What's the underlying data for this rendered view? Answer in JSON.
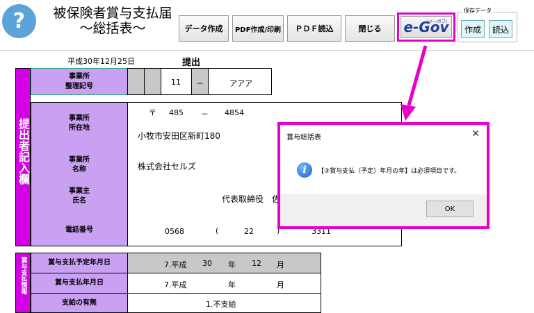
{
  "header": {
    "help_icon": "question-icon",
    "title_line1": "被保険者賞与支払届",
    "title_line2": "～総括表～"
  },
  "toolbar": {
    "create_data": "データ作成",
    "pdf_print": "PDF作成/印刷",
    "pdf_read": "ＰＤＦ読込",
    "close": "閉じる",
    "egov_prefix": "e-",
    "egov_main": "Gov",
    "egov_kana": "(イーガブ)"
  },
  "save_data": {
    "label": "保存データ",
    "create": "作成",
    "load": "読込"
  },
  "form": {
    "date": "平成30年12月25日",
    "submit": "提出",
    "section1_title": "提出者記入欄",
    "office_number_label": "事業所\n整理記号",
    "office_code_1": "11",
    "office_code_dash": "－",
    "office_code_2": "アアア",
    "address_label": "事業所\n所在地",
    "postal_mark": "〒",
    "postal_1": "485",
    "postal_dash": "－",
    "postal_2": "4854",
    "address": "小牧市安田区新町180",
    "name_label": "事業所\n名称",
    "name": "株式会社セルズ",
    "owner_label": "事業主\n氏名",
    "owner": "代表取締役　佐",
    "phone_label": "電話番号",
    "phone_1": "0568",
    "phone_open": "(",
    "phone_2": "22",
    "phone_close": ")",
    "phone_3": "3311",
    "section2_title": "賞与支払情報",
    "planned_label": "賞与支払予定年月日",
    "planned_era": "7.平成",
    "planned_year": "30",
    "planned_year_unit": "年",
    "planned_month": "12",
    "planned_month_unit": "月",
    "paid_label": "賞与支払年月日",
    "paid_era": "7.平成",
    "paid_year_unit": "年",
    "paid_month_unit": "月",
    "payment_label": "支給の有無",
    "payment_value": "1.不支給"
  },
  "dialog": {
    "title": "賞与総括表",
    "close_icon": "close-icon",
    "info_icon": "info-icon",
    "message": "【③賞与支払（予定）年月の年】は必須項目です。",
    "ok": "OK"
  },
  "colors": {
    "highlight": "#e600c8",
    "label_purple": "#c9a0f2",
    "section_magenta": "#d400e6"
  }
}
